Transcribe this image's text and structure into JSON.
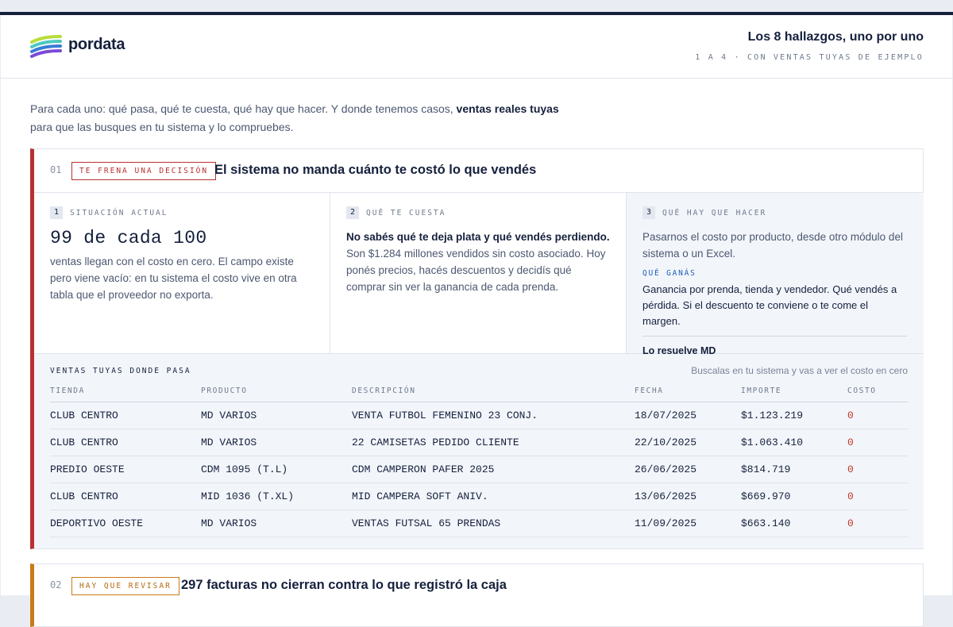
{
  "header": {
    "brand": "pordata",
    "title": "Los 8 hallazgos, uno por uno",
    "subtitle": "1 A 4 · CON VENTAS TUYAS DE EJEMPLO"
  },
  "intro": {
    "part1": "Para cada uno: qué pasa, qué te cuesta, qué hay que hacer. Y donde tenemos casos, ",
    "bold": "ventas reales tuyas",
    "part2": "para que las busques en tu sistema y lo compruebes."
  },
  "colors": {
    "red": "#b8312f",
    "amber": "#c97a16",
    "navy": "#15203c",
    "blue": "#1d5fb8"
  },
  "findings": [
    {
      "num": "01",
      "tag": "TE FRENA UNA DECISIÓN",
      "title": "El sistema no manda cuánto te costó lo que vendés",
      "situation": {
        "n": "1",
        "label": "SITUACIÓN ACTUAL",
        "big": "99 de cada 100",
        "text": "ventas llegan con el costo en cero. El campo existe pero viene vacío: en tu sistema el costo vive en otra tabla que el proveedor no exporta."
      },
      "cost": {
        "n": "2",
        "label": "QUÉ TE CUESTA",
        "lead": "No sabés qué te deja plata y qué vendés perdiendo.",
        "text": "Son $1.284 millones vendidos sin costo asociado. Hoy ponés precios, hacés descuentos y decidís qué comprar sin ver la ganancia de cada prenda."
      },
      "todo": {
        "n": "3",
        "label": "QUÉ HAY QUE HACER",
        "text": "Pasarnos el costo por producto, desde otro módulo del sistema o un Excel.",
        "gain_label": "QUÉ GANÁS",
        "gain_text": "Ganancia por prenda, tienda y vendedor. Qué vendés a pérdida. Si el descuento te conviene o te come el margen.",
        "resolve": "Lo resuelve MD"
      },
      "sales": {
        "title": "VENTAS TUYAS DONDE PASA",
        "hint": "Buscalas en tu sistema y vas a ver el costo en cero",
        "columns": [
          "TIENDA",
          "PRODUCTO",
          "DESCRIPCIÓN",
          "FECHA",
          "IMPORTE",
          "COSTO"
        ],
        "rows": [
          [
            "CLUB CENTRO",
            "MD VARIOS",
            "VENTA FUTBOL FEMENINO 23 CONJ.",
            "18/07/2025",
            "$1.123.219",
            "0"
          ],
          [
            "CLUB CENTRO",
            "MD VARIOS",
            "22 CAMISETAS PEDIDO CLIENTE",
            "22/10/2025",
            "$1.063.410",
            "0"
          ],
          [
            "PREDIO OESTE",
            "CDM 1095 (T.L)",
            "CDM CAMPERON PAFER 2025",
            "26/06/2025",
            "$814.719",
            "0"
          ],
          [
            "CLUB CENTRO",
            "MID 1036 (T.XL)",
            "MID CAMPERA SOFT ANIV.",
            "13/06/2025",
            "$669.970",
            "0"
          ],
          [
            "DEPORTIVO OESTE",
            "MD VARIOS",
            "VENTAS FUTSAL 65 PRENDAS",
            "11/09/2025",
            "$663.140",
            "0"
          ]
        ]
      }
    },
    {
      "num": "02",
      "tag": "HAY QUE REVISAR",
      "title": "297 facturas no cierran contra lo que registró la caja"
    }
  ]
}
